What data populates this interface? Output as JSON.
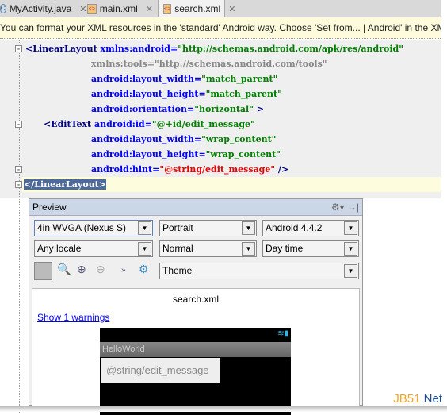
{
  "tabs": [
    {
      "label": "MyActivity.java",
      "icon": "java-class-icon"
    },
    {
      "label": "main.xml",
      "icon": "xml-file-icon"
    },
    {
      "label": "search.xml",
      "icon": "xml-file-icon",
      "active": true
    }
  ],
  "notice": "You can format your XML resources in the 'standard' Android way. Choose 'Set from... | Android' in the XML code style settings",
  "code": {
    "l1_tag": "<LinearLayout",
    "l1_attr": " xmlns:android=",
    "l1_val": "\"http://schemas.android.com/apk/res/android\"",
    "l2": "xmlns:tools=\"http://schemas.android.com/tools\"",
    "l3_attr": "android:layout_width=",
    "l3_val": "\"match_parent\"",
    "l4_attr": "android:layout_height=",
    "l4_val": "\"match_parent\"",
    "l5_attr": "android:orientation=",
    "l5_val": "\"horizontal\"",
    "l5_end": " >",
    "l6_tag": "<EditText",
    "l6_attr": " android:id=",
    "l6_val": "\"@+id/edit_message\"",
    "l7_attr": "android:layout_width=",
    "l7_val": "\"wrap_content\"",
    "l8_attr": "android:layout_height=",
    "l8_val": "\"wrap_content\"",
    "l9_attr": "android:hint=",
    "l9_val": "\"@string/edit_message\"",
    "l9_end": " />",
    "l10": "</LinearLayout>"
  },
  "preview": {
    "title": "Preview",
    "device": "4in WVGA (Nexus S)",
    "orientation": "Portrait",
    "api": "Android 4.4.2",
    "locale": "Any locale",
    "size": "Normal",
    "time": "Day time",
    "theme": "Theme",
    "file": "search.xml",
    "warnings": "Show 1 warnings",
    "app_title": "HelloWorld",
    "hint": "@string/edit_message"
  },
  "watermark": {
    "a": "JB51",
    "b": ".Net"
  }
}
